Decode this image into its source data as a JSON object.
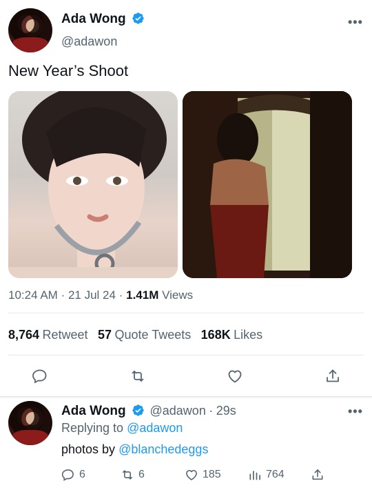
{
  "tweet": {
    "author_name": "Ada Wong",
    "author_handle": "@adawon",
    "text": "New Year’s Shoot",
    "time": "10:24 AM",
    "sep1": "·",
    "date": "21 Jul 24",
    "sep2": "·",
    "views_count": "1.41M",
    "views_label": "Views",
    "stats": {
      "retweets_count": "8,764",
      "retweets_label": "Retweet",
      "quotes_count": "57",
      "quotes_label": "Quote Tweets",
      "likes_count": "168K",
      "likes_label": "Likes"
    },
    "more_label": "•••"
  },
  "reply": {
    "author_name": "Ada Wong",
    "author_handle": "@adawon",
    "sep": "·",
    "age": "29s",
    "replying_to_prefix": "Replying to",
    "replying_to_handle": "@adawon",
    "text_prefix": "photos by",
    "text_mention": "@blanchedeggs",
    "more_label": "•••",
    "counts": {
      "replies": "6",
      "retweets": "6",
      "likes": "185",
      "views": "764"
    }
  },
  "colors": {
    "accent": "#1d9bf0",
    "text": "#0f1419",
    "muted": "#536471",
    "divider": "#e6e9eb"
  },
  "icons": [
    "verified-badge-icon",
    "more-icon",
    "reply-icon",
    "retweet-icon",
    "like-icon",
    "share-icon",
    "views-icon"
  ]
}
